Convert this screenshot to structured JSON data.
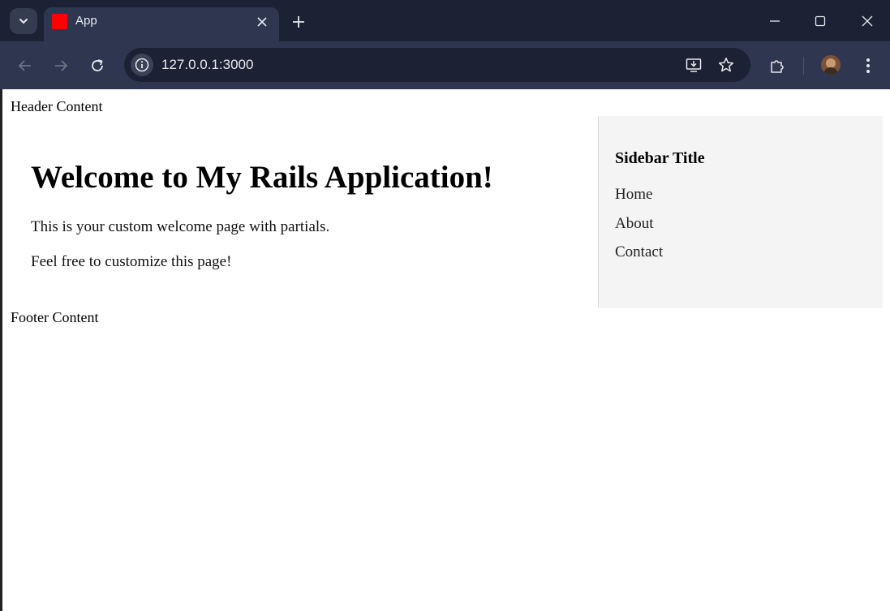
{
  "browser": {
    "tab": {
      "title": "App",
      "favicon_color": "#ff0000"
    },
    "url": "127.0.0.1:3000",
    "icons": {
      "tab_search": "chevron-down-icon",
      "tab_close": "close-icon",
      "new_tab": "plus-icon",
      "minimize": "minimize-icon",
      "maximize": "maximize-icon",
      "close_window": "close-icon",
      "back": "arrow-left-icon",
      "forward": "arrow-right-icon",
      "reload": "reload-icon",
      "site_info": "info-icon",
      "install": "install-app-icon",
      "bookmark": "star-icon",
      "extensions": "puzzle-icon",
      "menu": "more-vert-icon"
    },
    "colors": {
      "tabstrip": "#1b2234",
      "toolbar": "#2f3750",
      "omnibox": "#1c2233"
    }
  },
  "page": {
    "header": "Header Content",
    "main": {
      "title": "Welcome to My Rails Application!",
      "paragraphs": [
        "This is your custom welcome page with partials.",
        "Feel free to customize this page!"
      ]
    },
    "sidebar": {
      "title": "Sidebar Title",
      "links": [
        "Home",
        "About",
        "Contact"
      ],
      "background": "#f4f4f4"
    },
    "footer": "Footer Content"
  }
}
